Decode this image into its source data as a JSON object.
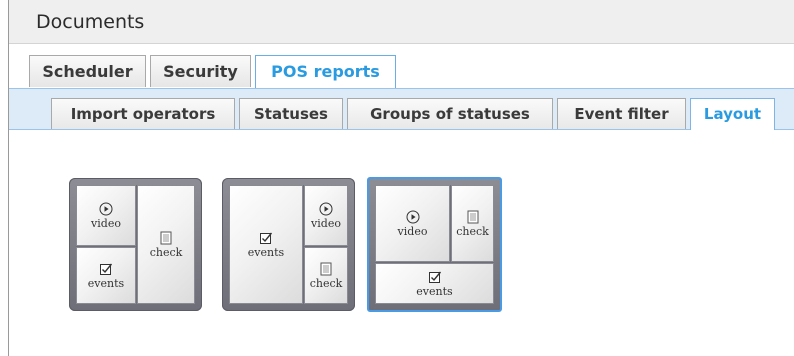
{
  "header": {
    "title": "Documents"
  },
  "main_tabs": [
    {
      "label": "Scheduler",
      "active": false
    },
    {
      "label": "Security",
      "active": false
    },
    {
      "label": "POS reports",
      "active": true
    }
  ],
  "sub_tabs": [
    {
      "label": "Import operators",
      "active": false
    },
    {
      "label": "Statuses",
      "active": false
    },
    {
      "label": "Groups of statuses",
      "active": false
    },
    {
      "label": "Event filter",
      "active": false
    },
    {
      "label": "Layout",
      "active": true
    }
  ],
  "layouts": [
    {
      "selected": false,
      "cells": [
        {
          "icon": "play-circle-icon",
          "label": "video"
        },
        {
          "icon": "document-icon",
          "label": "check"
        },
        {
          "icon": "checkbox-icon",
          "label": "events"
        }
      ]
    },
    {
      "selected": false,
      "cells": [
        {
          "icon": "checkbox-icon",
          "label": "events"
        },
        {
          "icon": "play-circle-icon",
          "label": "video"
        },
        {
          "icon": "document-icon",
          "label": "check"
        }
      ]
    },
    {
      "selected": true,
      "cells": [
        {
          "icon": "play-circle-icon",
          "label": "video"
        },
        {
          "icon": "document-icon",
          "label": "check"
        },
        {
          "icon": "checkbox-icon",
          "label": "events"
        }
      ]
    }
  ],
  "colors": {
    "accent": "#2a9be0",
    "band": "#ddeaf8",
    "tile": "#7a7a84"
  }
}
